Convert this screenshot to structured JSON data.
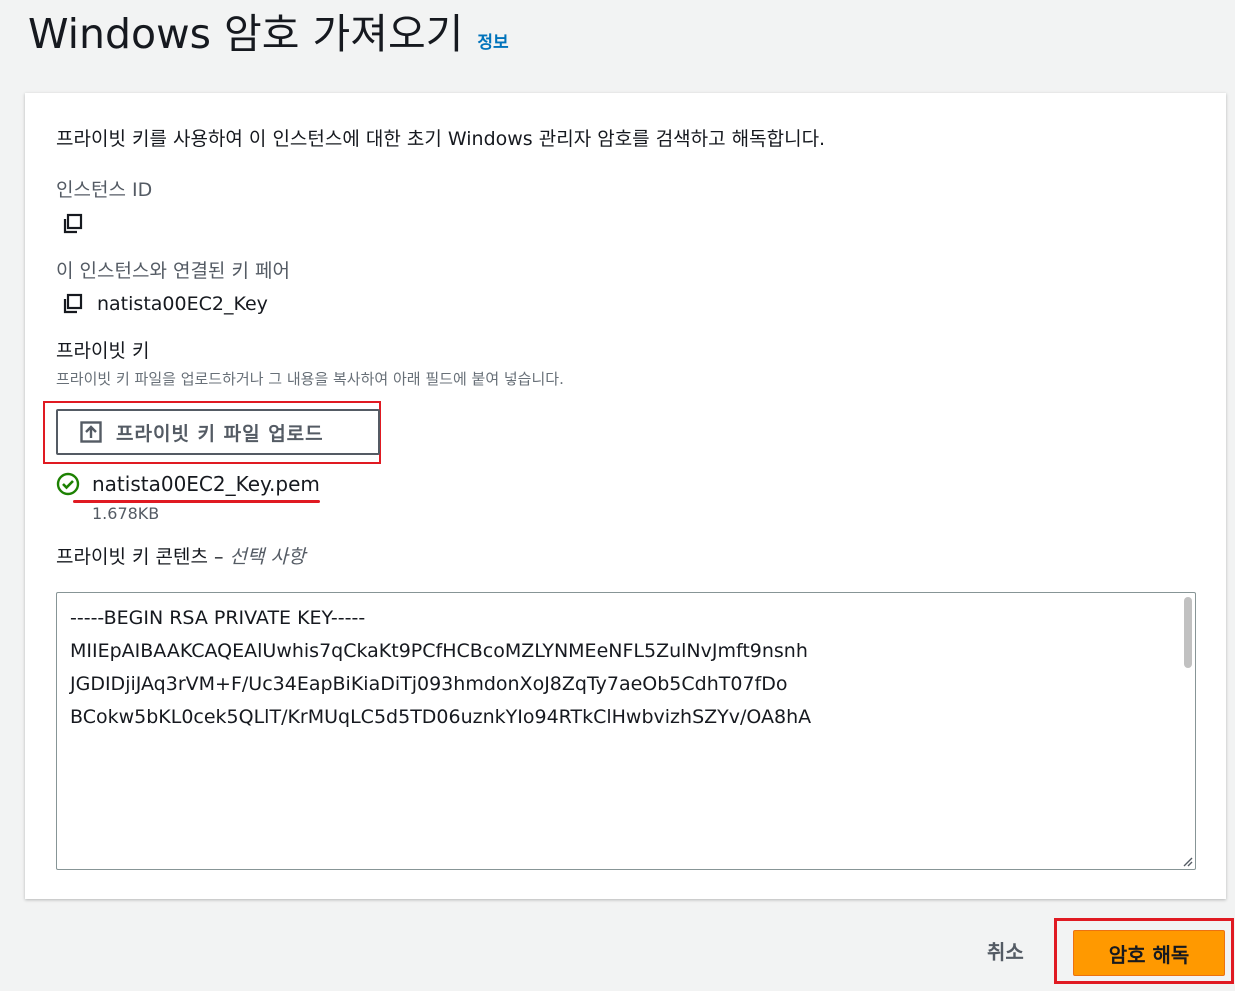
{
  "header": {
    "title": "Windows 암호 가져오기",
    "info_link": "정보"
  },
  "form": {
    "description": "프라이빗 키를 사용하여 이 인스턴스에 대한 초기 Windows 관리자 암호를 검색하고 해독합니다.",
    "instance_id": {
      "label": "인스턴스 ID",
      "value": ""
    },
    "key_pair": {
      "label": "이 인스턴스와 연결된 키 페어",
      "value": "natista00EC2_Key"
    },
    "private_key": {
      "label": "프라이빗 키",
      "hint": "프라이빗 키 파일을 업로드하거나 그 내용을 복사하여 아래 필드에 붙여 넣습니다.",
      "upload_button": "프라이빗 키 파일 업로드",
      "file_name": "natista00EC2_Key.pem",
      "file_size": "1.678KB"
    },
    "key_content": {
      "label": "프라이빗 키 콘텐츠 –",
      "optional": "선택 사항",
      "lines": [
        "-----BEGIN RSA PRIVATE KEY-----",
        "MIIEpAIBAAKCAQEAlUwhis7qCkaKt9PCfHCBcoMZLYNMEeNFL5ZulNvJmft9nsnh",
        "JGDIDjiJAq3rVM+F/Uc34EapBiKiaDiTj093hmdonXoJ8ZqTy7aeOb5CdhT07fDo",
        "BCokw5bKL0cek5QLlT/KrMUqLC5d5TD06uznkYIo94RTkClHwbvizhSZYv/OA8hA"
      ]
    }
  },
  "footer": {
    "cancel_label": "취소",
    "decrypt_label": "암호 해독"
  },
  "colors": {
    "accent": "#ff9900",
    "link": "#0073bb",
    "success": "#1d8102",
    "highlight": "#e01a22"
  }
}
